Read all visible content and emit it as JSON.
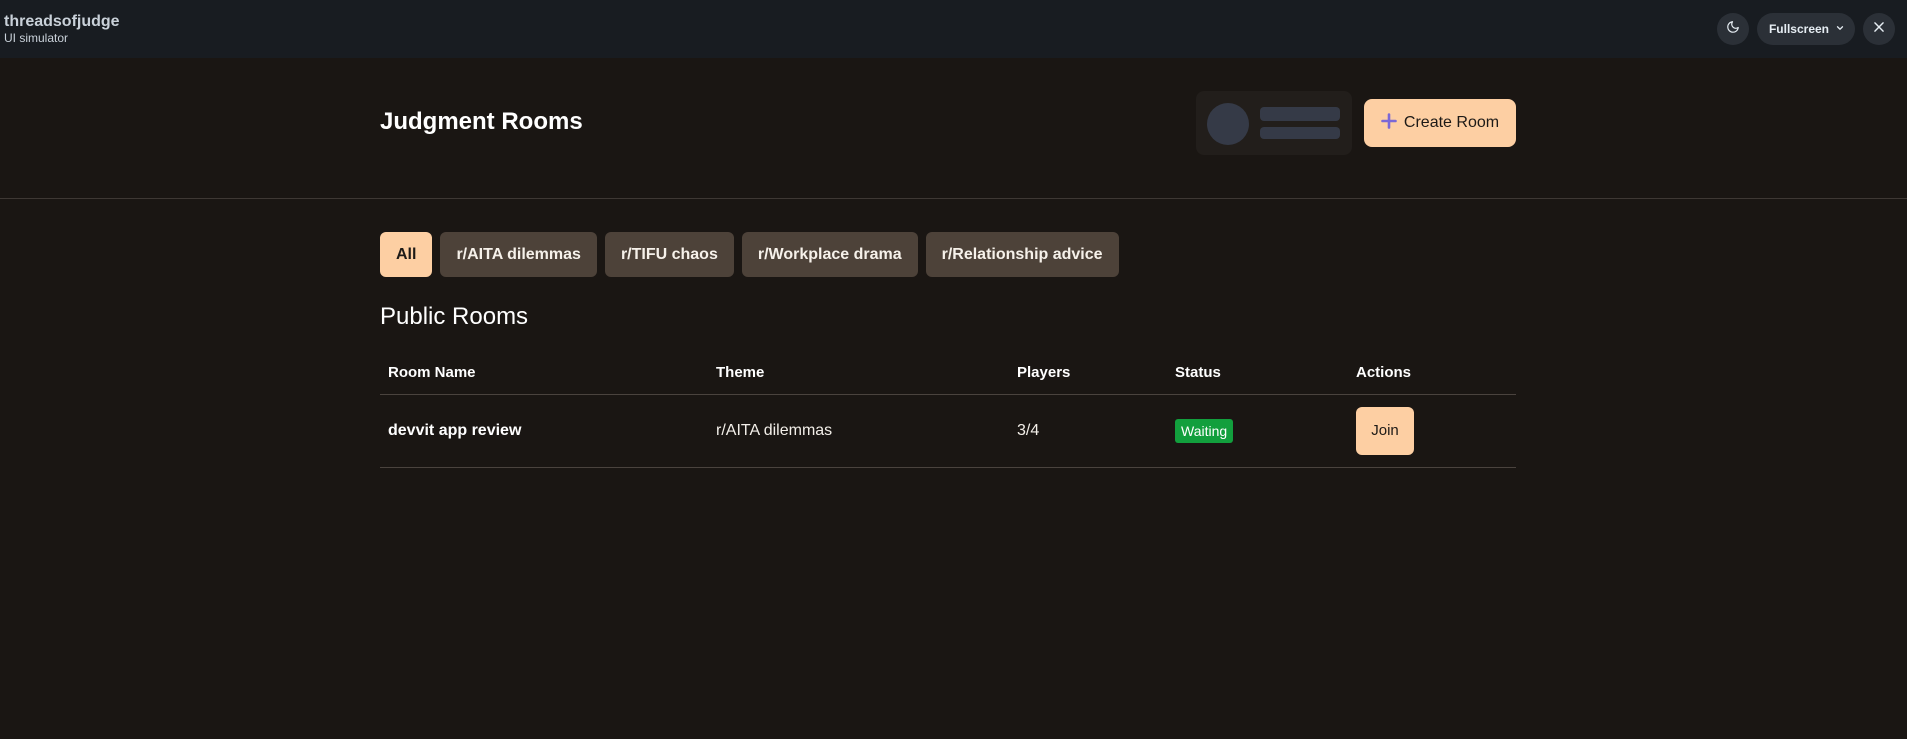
{
  "simulator": {
    "app_name": "threadsofjudge",
    "subtitle": "UI simulator",
    "fullscreen_label": "Fullscreen",
    "icons": {
      "theme": "moon-icon",
      "fullscreen_caret": "chevron-down-icon",
      "close": "close-icon"
    }
  },
  "header": {
    "title": "Judgment Rooms",
    "create_label": "Create Room",
    "create_icon": "plus-icon"
  },
  "filters": [
    {
      "label": "All",
      "active": true
    },
    {
      "label": "r/AITA dilemmas",
      "active": false
    },
    {
      "label": "r/TIFU chaos",
      "active": false
    },
    {
      "label": "r/Workplace drama",
      "active": false
    },
    {
      "label": "r/Relationship advice",
      "active": false
    }
  ],
  "public_rooms": {
    "title": "Public Rooms",
    "columns": [
      "Room Name",
      "Theme",
      "Players",
      "Status",
      "Actions"
    ],
    "rows": [
      {
        "name": "devvit app review",
        "theme": "r/AITA dilemmas",
        "players": "3/4",
        "status": "Waiting",
        "action": "Join"
      }
    ]
  },
  "colors": {
    "background": "#1a1613",
    "topbar": "#181c21",
    "accent": "#fdcfa3",
    "chip": "#4d4239",
    "status_waiting": "#129f3d",
    "plus_icon": "#7b68d6"
  }
}
